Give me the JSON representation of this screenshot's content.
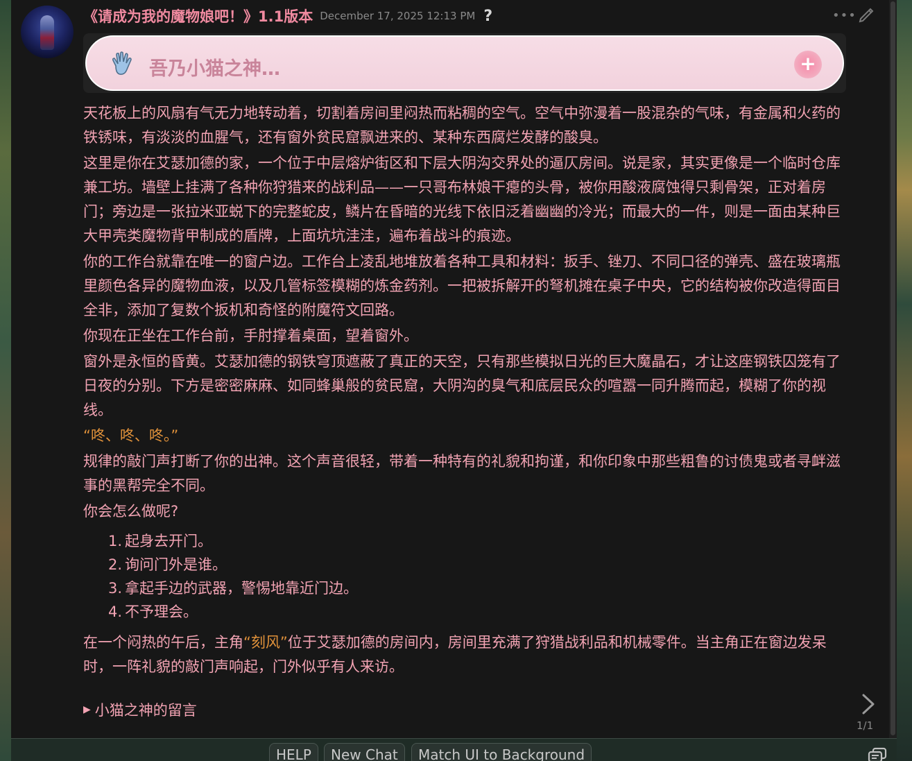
{
  "message": {
    "character_name": "《请成为我的魔物娘吧！》1.1版本",
    "timestamp": "December 17, 2025 12:13 PM",
    "status_text": "吾乃小猫之神…",
    "paragraphs": [
      "天花板上的风扇有气无力地转动着，切割着房间里闷热而粘稠的空气。空气中弥漫着一股混杂的气味，有金属和火药的铁锈味，有淡淡的血腥气，还有窗外贫民窟飘进来的、某种东西腐烂发酵的酸臭。",
      "这里是你在艾瑟加德的家，一个位于中层熔炉街区和下层大阴沟交界处的逼仄房间。说是家，其实更像是一个临时仓库兼工坊。墙壁上挂满了各种你狩猎来的战利品——一只哥布林娘干瘪的头骨，被你用酸液腐蚀得只剩骨架，正对着房门；旁边是一张拉米亚蜕下的完整蛇皮，鳞片在昏暗的光线下依旧泛着幽幽的冷光；而最大的一件，则是一面由某种巨大甲壳类魔物背甲制成的盾牌，上面坑坑洼洼，遍布着战斗的痕迹。",
      "你的工作台就靠在唯一的窗户边。工作台上凌乱地堆放着各种工具和材料：扳手、锉刀、不同口径的弹壳、盛在玻璃瓶里颜色各异的魔物血液，以及几管标签模糊的炼金药剂。一把被拆解开的弩机摊在桌子中央，它的结构被你改造得面目全非，添加了复数个扳机和奇怪的附魔符文回路。",
      "你现在正坐在工作台前，手肘撑着桌面，望着窗外。",
      "窗外是永恒的昏黄。艾瑟加德的钢铁穹顶遮蔽了真正的天空，只有那些模拟日光的巨大魔晶石，才让这座钢铁囚笼有了日夜的分别。下方是密密麻麻、如同蜂巢般的贫民窟，大阴沟的臭气和底层民众的喧嚣一同升腾而起，模糊了你的视线。"
    ],
    "quote": "“咚、咚、咚。”",
    "paragraphs_after": [
      "规律的敲门声打断了你的出神。这个声音很轻，带着一种特有的礼貌和拘谨，和你印象中那些粗鲁的讨债鬼或者寻衅滋事的黑帮完全不同。",
      "你会怎么做呢?"
    ],
    "options": [
      {
        "num": "1.",
        "text": "起身去开门。"
      },
      {
        "num": "2.",
        "text": "询问门外是谁。"
      },
      {
        "num": "3.",
        "text": "拿起手边的武器，警惕地靠近门边。"
      },
      {
        "num": "4.",
        "text": "不予理会。"
      }
    ],
    "summary_before": "在一个闷热的午后，主角",
    "summary_name": "“刻风”",
    "summary_after": "位于艾瑟加德的房间内，房间里充满了狩猎战利品和机械零件。当主角正在窗边发呆时，一阵礼貌的敲门声响起，门外似乎有人来访。",
    "details_label": "小猫之神的留言",
    "swipe_counter": "1/1"
  },
  "quick_replies": [
    "HELP",
    "New Chat",
    "Match UI to Background"
  ],
  "icons": {
    "avatar": "character-avatar",
    "help": "question-mark-icon",
    "more": "ellipsis-icon",
    "edit": "pencil-icon",
    "status": "hand-icon",
    "add": "plus-icon",
    "swipe": "chevron-right-icon",
    "quick_reply_menu": "quick-reply-icon"
  },
  "colors": {
    "panel": "#171717",
    "text": "#f2a3b3",
    "quote": "#e0913a",
    "name": "#f08aa0"
  }
}
